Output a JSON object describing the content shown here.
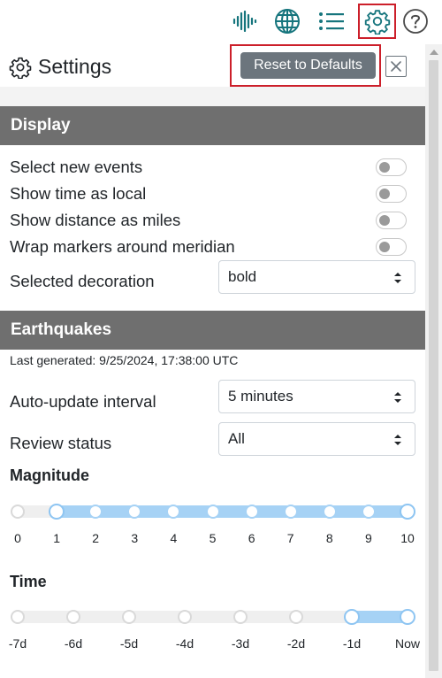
{
  "toolbar": {
    "icons": [
      "seismograph-icon",
      "globe-icon",
      "list-icon",
      "gear-icon",
      "help-icon"
    ],
    "accent_color": "#16757d"
  },
  "settings": {
    "title": "Settings",
    "reset_label": "Reset to Defaults",
    "close_symbol": "✕"
  },
  "display": {
    "section_label": "Display",
    "toggles": [
      {
        "label": "Select new events",
        "on": false
      },
      {
        "label": "Show time as local",
        "on": false
      },
      {
        "label": "Show distance as miles",
        "on": false
      },
      {
        "label": "Wrap markers around meridian",
        "on": false
      }
    ],
    "decoration": {
      "label": "Selected decoration",
      "value": "bold"
    }
  },
  "earthquakes": {
    "section_label": "Earthquakes",
    "last_generated": "Last generated: 9/25/2024, 17:38:00 UTC",
    "auto_update": {
      "label": "Auto-update interval",
      "value": "5 minutes"
    },
    "review_status": {
      "label": "Review status",
      "value": "All"
    },
    "magnitude": {
      "label": "Magnitude",
      "ticks": [
        "0",
        "1",
        "2",
        "3",
        "4",
        "5",
        "6",
        "7",
        "8",
        "9",
        "10"
      ],
      "range": [
        1,
        10
      ]
    },
    "time": {
      "label": "Time",
      "ticks": [
        "-7d",
        "-6d",
        "-5d",
        "-4d",
        "-3d",
        "-2d",
        "-1d",
        "Now"
      ],
      "range": [
        "-1d",
        "Now"
      ]
    }
  },
  "colors": {
    "section_bar": "#6f6f6f",
    "highlight_outline": "#cc1f2a",
    "slider_fill": "#a6d2f5"
  }
}
